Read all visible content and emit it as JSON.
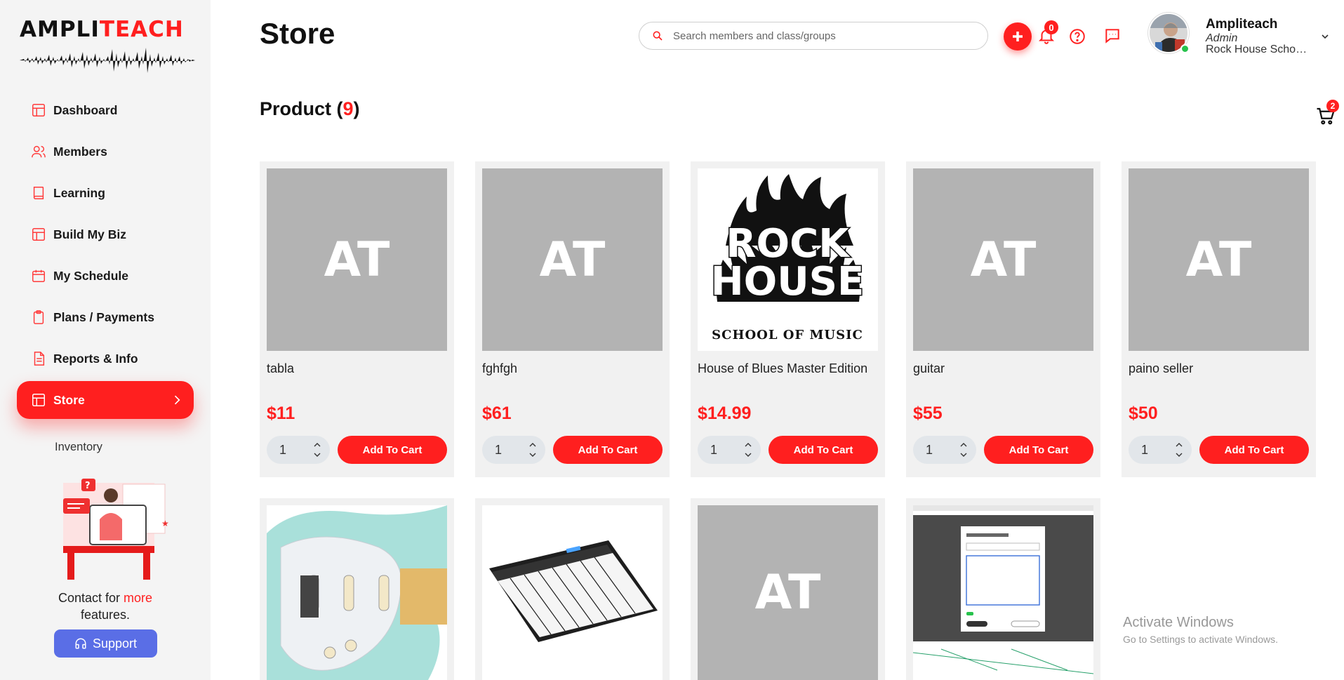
{
  "brand": {
    "part1": "AMPLI",
    "part2": "TEACH"
  },
  "sidebar": {
    "items": [
      {
        "label": "Dashboard",
        "icon": "layout-icon"
      },
      {
        "label": "Members",
        "icon": "users-icon"
      },
      {
        "label": "Learning",
        "icon": "book-icon"
      },
      {
        "label": "Build My Biz",
        "icon": "layout-icon"
      },
      {
        "label": "My Schedule",
        "icon": "calendar-icon"
      },
      {
        "label": "Plans / Payments",
        "icon": "clipboard-icon"
      },
      {
        "label": "Reports & Info",
        "icon": "document-icon"
      },
      {
        "label": "Store",
        "icon": "layout-icon",
        "active": true
      }
    ],
    "subitem": "Inventory",
    "contact_prefix": "Contact for ",
    "contact_highlight": "more",
    "contact_suffix": "features.",
    "support_label": "Support"
  },
  "header": {
    "title": "Store",
    "search_placeholder": "Search members and class/groups",
    "notification_count": "0",
    "user_name": "Ampliteach",
    "user_role": "Admin",
    "user_org": "Rock House School of Music"
  },
  "products_section": {
    "heading": "Product",
    "count": "9",
    "cart_count": "2"
  },
  "products": [
    {
      "name": "tabla",
      "price": "$11",
      "qty": "1",
      "image": "AT",
      "add_label": "Add To Cart"
    },
    {
      "name": "fghfgh",
      "price": "$61",
      "qty": "1",
      "image": "AT",
      "add_label": "Add To Cart"
    },
    {
      "name": "House of Blues Master Edition",
      "price": "$14.99",
      "qty": "1",
      "image": "rock-house-logo",
      "add_label": "Add To Cart"
    },
    {
      "name": "guitar",
      "price": "$55",
      "qty": "1",
      "image": "AT",
      "add_label": "Add To Cart"
    },
    {
      "name": "paino seller",
      "price": "$50",
      "qty": "1",
      "image": "AT",
      "add_label": "Add To Cart"
    },
    {
      "image": "electric-guitar-photo"
    },
    {
      "image": "keyboard-photo"
    },
    {
      "image": "AT"
    },
    {
      "image": "screenshot-thumbnail"
    }
  ],
  "placeholder_text": "AT",
  "watermark": {
    "line1": "Activate Windows",
    "line2": "Go to Settings to activate Windows."
  },
  "colors": {
    "accent": "#ff1f1f",
    "support": "#5a6ee6",
    "placeholder_bg": "#b3b3b3"
  }
}
